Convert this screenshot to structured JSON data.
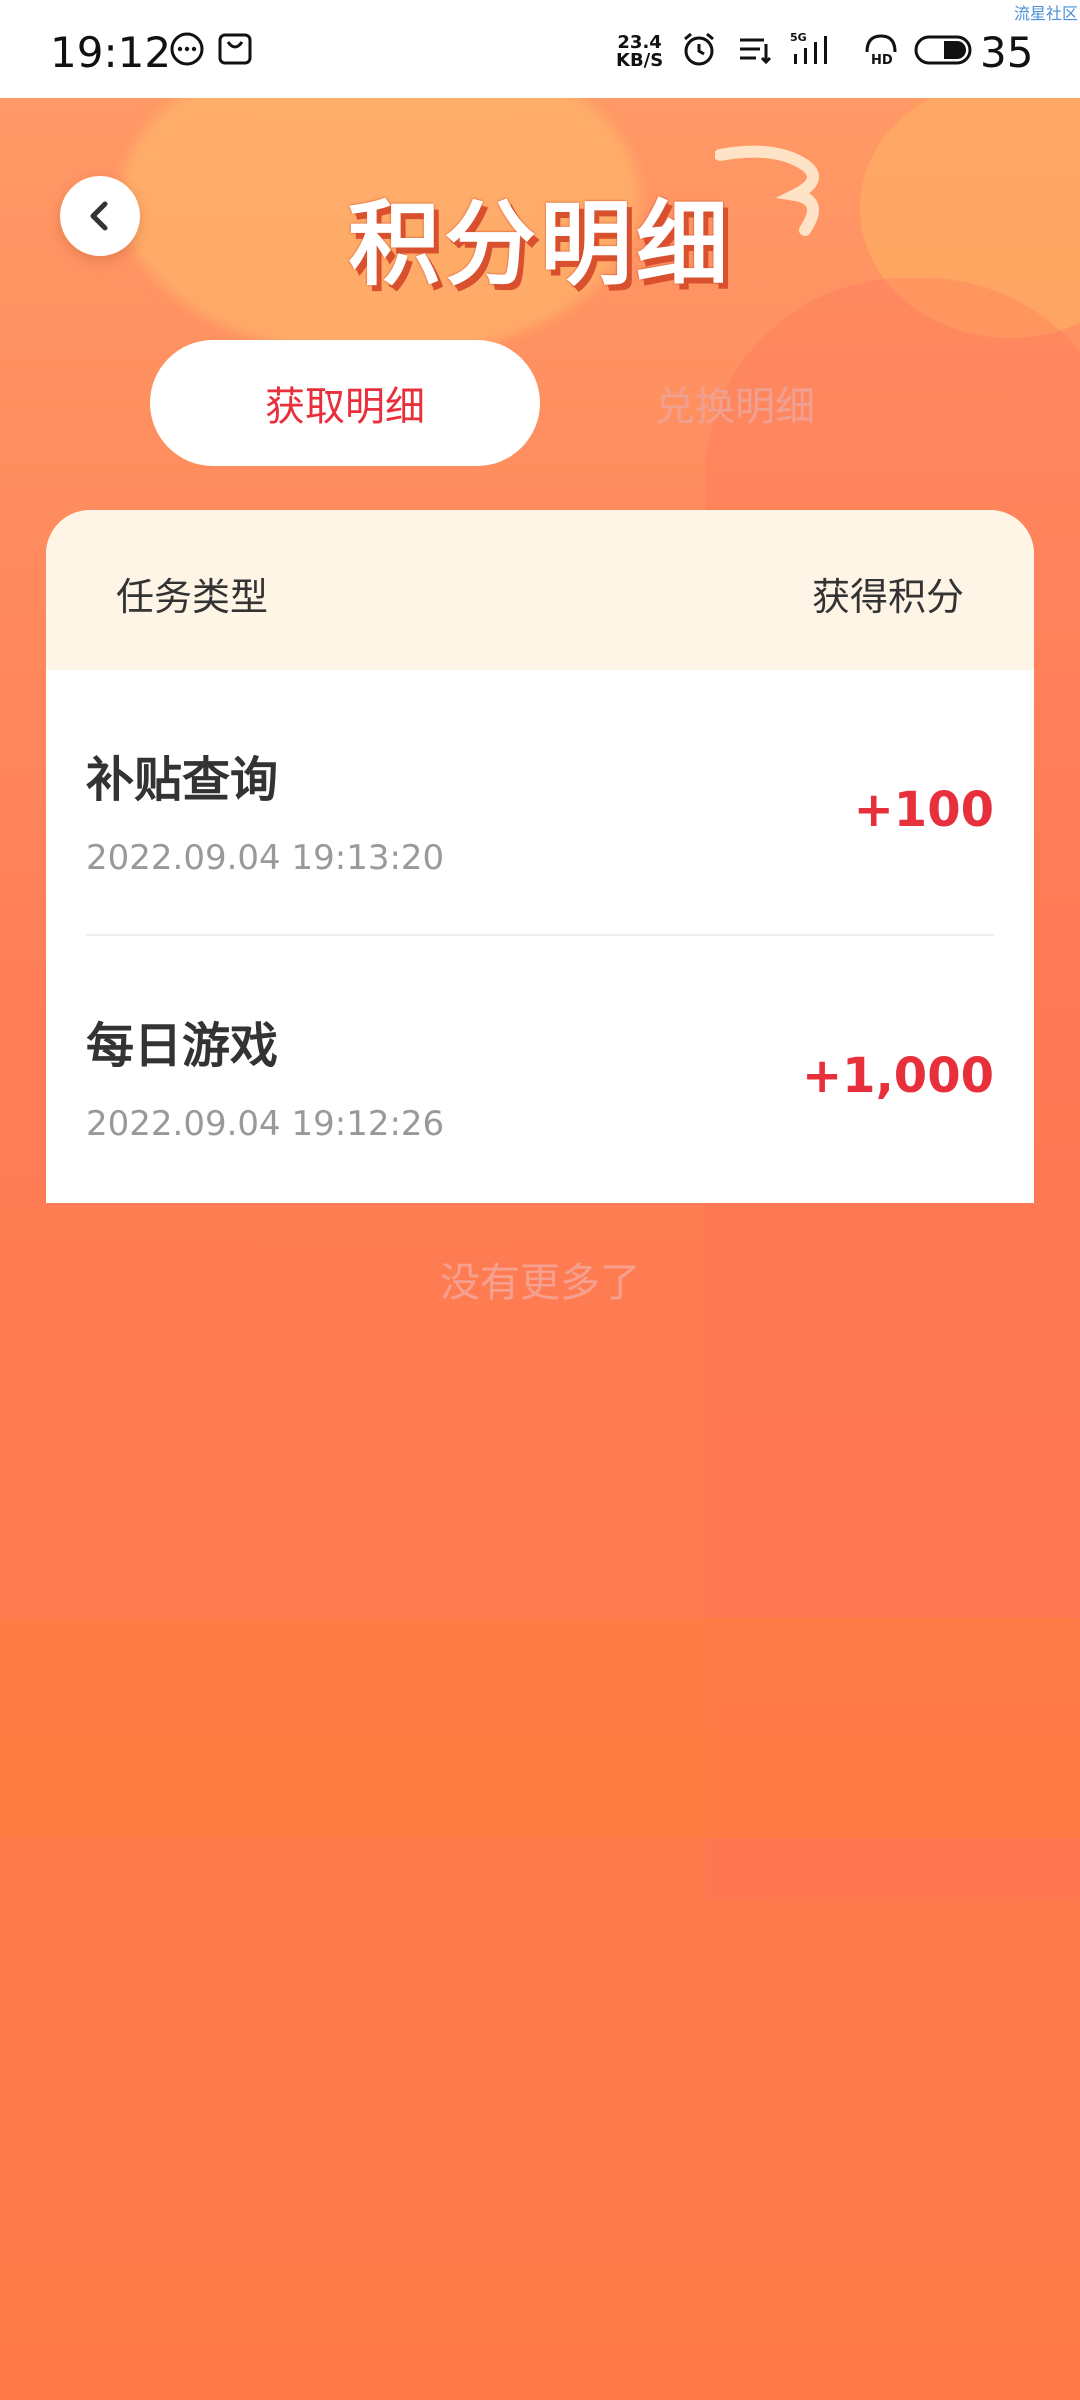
{
  "status_bar": {
    "time": "19:12",
    "net_speed_value": "23.4",
    "net_speed_unit": "KB/S",
    "network_type": "5G",
    "battery": "35",
    "watermark": "流星社区"
  },
  "header": {
    "title": "积分明细"
  },
  "tabs": [
    {
      "label": "获取明细",
      "active": true
    },
    {
      "label": "兑换明细",
      "active": false
    }
  ],
  "table": {
    "col_task": "任务类型",
    "col_points": "获得积分",
    "rows": [
      {
        "title": "补贴查询",
        "time": "2022.09.04 19:13:20",
        "points": "+100"
      },
      {
        "title": "每日游戏",
        "time": "2022.09.04 19:12:26",
        "points": "+1,000"
      }
    ]
  },
  "footer": {
    "no_more": "没有更多了"
  },
  "colors": {
    "accent": "#e8303c",
    "header_bg": "#fff5e6",
    "page_bg": "#ff7a4a"
  }
}
